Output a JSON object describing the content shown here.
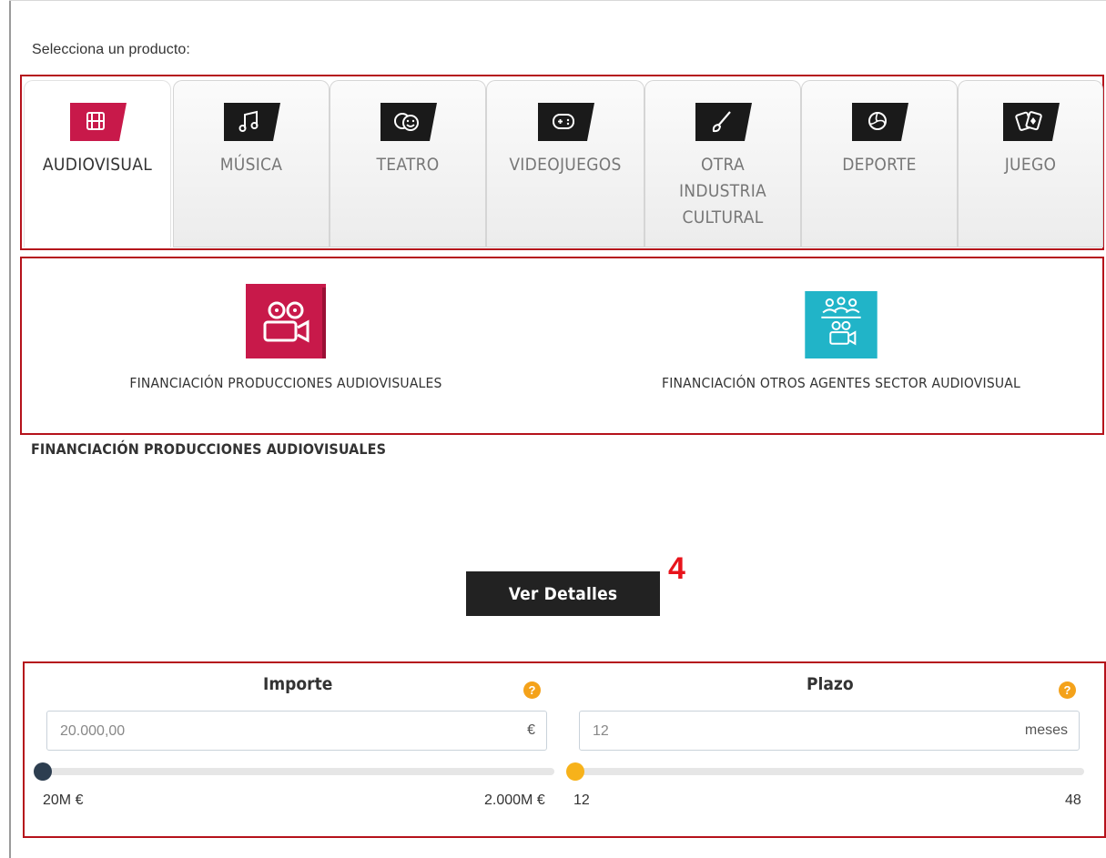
{
  "prompt": "Selecciona un producto:",
  "tabs": [
    {
      "label": "AUDIOVISUAL",
      "icon": "film-icon",
      "active": true
    },
    {
      "label": "MÚSICA",
      "icon": "music-note-icon",
      "active": false
    },
    {
      "label": "TEATRO",
      "icon": "theater-masks-icon",
      "active": false
    },
    {
      "label": "VIDEOJUEGOS",
      "icon": "gamepad-icon",
      "active": false
    },
    {
      "label": "OTRA\nINDUSTRIA\nCULTURAL",
      "icon": "paintbrush-icon",
      "active": false
    },
    {
      "label": "DEPORTE",
      "icon": "volleyball-icon",
      "active": false
    },
    {
      "label": "JUEGO",
      "icon": "playing-cards-icon",
      "active": false
    }
  ],
  "products": [
    {
      "label": "FINANCIACIÓN PRODUCCIONES AUDIOVISUALES",
      "icon": "film-camera-icon",
      "color": "#c8194a"
    },
    {
      "label": "FINANCIACIÓN OTROS AGENTES SECTOR AUDIOVISUAL",
      "icon": "audience-camera-icon",
      "color": "#21b4c8"
    }
  ],
  "section_title": "FINANCIACIÓN PRODUCCIONES AUDIOVISUALES",
  "details_button": "Ver Detalles",
  "step_number": "4",
  "calculator": {
    "importe": {
      "title": "Importe",
      "value": "20.000,00",
      "unit": "€",
      "min_label": "20M €",
      "max_label": "2.000M €",
      "slider_position": 0,
      "thumb_color": "#2d3e50"
    },
    "plazo": {
      "title": "Plazo",
      "value": "12",
      "unit": "meses",
      "min_label": "12",
      "max_label": "48",
      "slider_position": 0,
      "thumb_color": "#f7b21a"
    },
    "help_symbol": "?"
  },
  "colors": {
    "accent": "#c8194a",
    "highlight_border": "#b5121b",
    "help": "#f4a21a"
  }
}
